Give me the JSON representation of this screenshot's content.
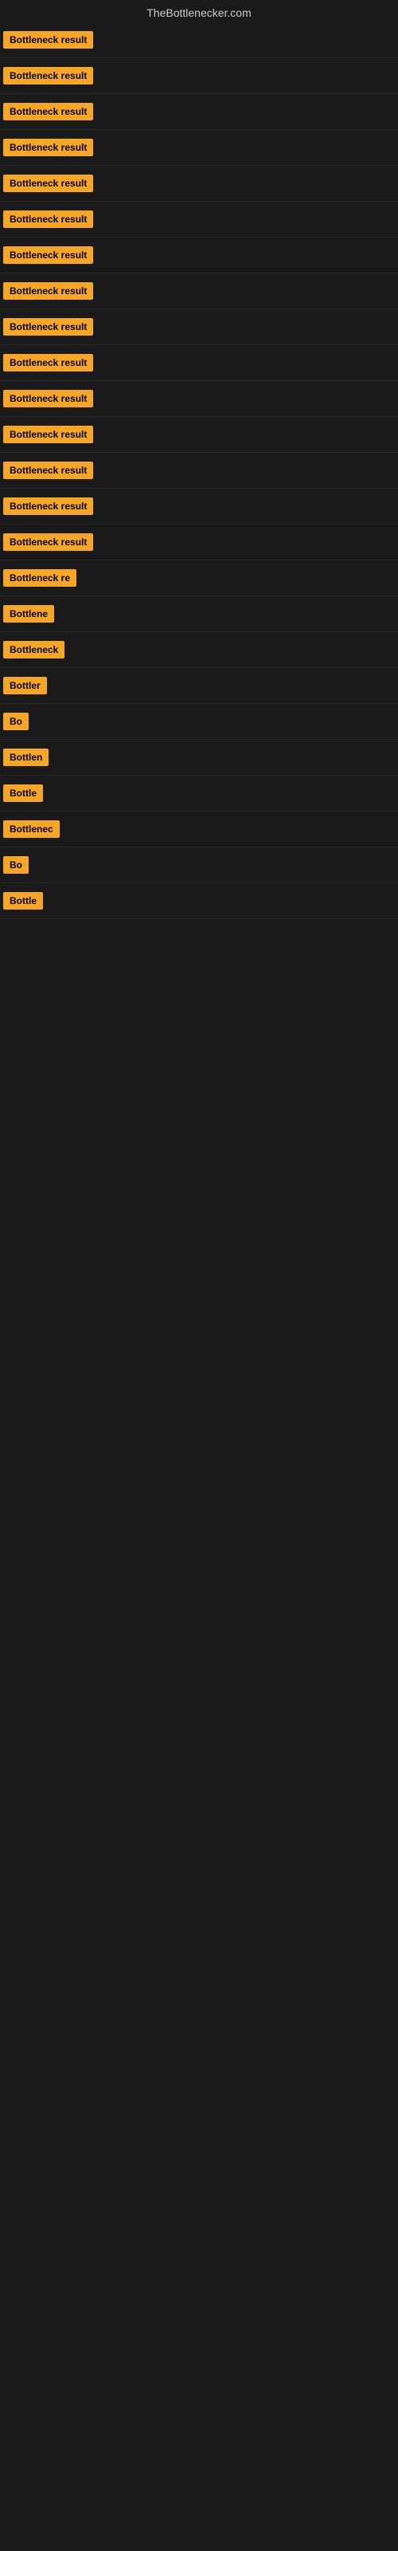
{
  "site": {
    "title": "TheBottlenecker.com"
  },
  "results": [
    {
      "id": 1,
      "label": "Bottleneck result",
      "visible_width": "full"
    },
    {
      "id": 2,
      "label": "Bottleneck result",
      "visible_width": "full"
    },
    {
      "id": 3,
      "label": "Bottleneck result",
      "visible_width": "full"
    },
    {
      "id": 4,
      "label": "Bottleneck result",
      "visible_width": "full"
    },
    {
      "id": 5,
      "label": "Bottleneck result",
      "visible_width": "full"
    },
    {
      "id": 6,
      "label": "Bottleneck result",
      "visible_width": "full"
    },
    {
      "id": 7,
      "label": "Bottleneck result",
      "visible_width": "full"
    },
    {
      "id": 8,
      "label": "Bottleneck result",
      "visible_width": "full"
    },
    {
      "id": 9,
      "label": "Bottleneck result",
      "visible_width": "full"
    },
    {
      "id": 10,
      "label": "Bottleneck result",
      "visible_width": "full"
    },
    {
      "id": 11,
      "label": "Bottleneck result",
      "visible_width": "full"
    },
    {
      "id": 12,
      "label": "Bottleneck result",
      "visible_width": "full"
    },
    {
      "id": 13,
      "label": "Bottleneck result",
      "visible_width": "full"
    },
    {
      "id": 14,
      "label": "Bottleneck result",
      "visible_width": "full"
    },
    {
      "id": 15,
      "label": "Bottleneck result",
      "visible_width": "90"
    },
    {
      "id": 16,
      "label": "Bottleneck re",
      "visible_width": "75"
    },
    {
      "id": 17,
      "label": "Bottlene",
      "visible_width": "60"
    },
    {
      "id": 18,
      "label": "Bottleneck",
      "visible_width": "65"
    },
    {
      "id": 19,
      "label": "Bottler",
      "visible_width": "50"
    },
    {
      "id": 20,
      "label": "Bo",
      "visible_width": "30"
    },
    {
      "id": 21,
      "label": "Bottlen",
      "visible_width": "52"
    },
    {
      "id": 22,
      "label": "Bottle",
      "visible_width": "45"
    },
    {
      "id": 23,
      "label": "Bottlenec",
      "visible_width": "62"
    },
    {
      "id": 24,
      "label": "Bo",
      "visible_width": "30"
    },
    {
      "id": 25,
      "label": "Bottle",
      "visible_width": "45"
    }
  ]
}
